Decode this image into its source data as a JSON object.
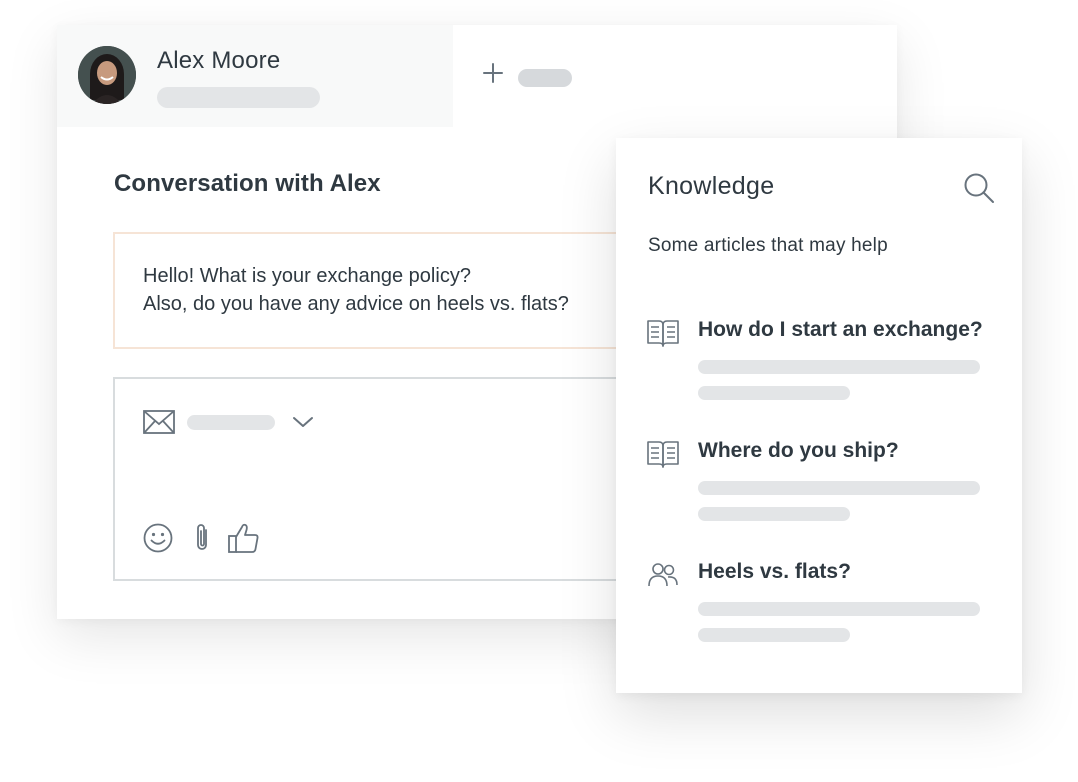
{
  "header": {
    "contact_name": "Alex Moore",
    "avatar_icon": "avatar",
    "new_tab_icon": "plus-icon"
  },
  "conversation": {
    "title": "Conversation with Alex",
    "message_lines": [
      "Hello! What is your exchange policy?",
      "Also, do you have any advice on heels vs. flats?"
    ]
  },
  "composer": {
    "channel_icon": "envelope-icon",
    "dropdown_icon": "chevron-down-icon",
    "toolbar_icons": [
      "emoji-icon",
      "paperclip-icon",
      "thumbs-up-icon"
    ]
  },
  "knowledge": {
    "title": "Knowledge",
    "search_icon": "search-icon",
    "subtitle": "Some articles that may help",
    "articles": [
      {
        "title": "How do I start an exchange?",
        "icon": "book-icon"
      },
      {
        "title": "Where do you ship?",
        "icon": "book-icon"
      },
      {
        "title": "Heels vs. flats?",
        "icon": "people-icon"
      }
    ]
  },
  "colors": {
    "text": "#2f3941",
    "placeholder": "#e3e5e7",
    "message_border": "#f6e4d6",
    "composer_border": "#d8dcde",
    "active_tab_bg": "#f8f9f9"
  }
}
